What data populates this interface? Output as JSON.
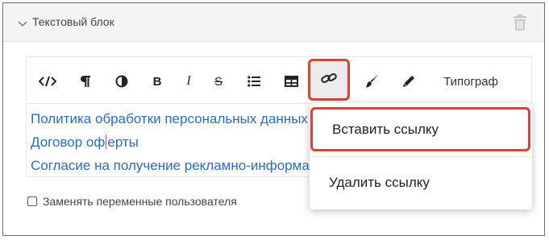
{
  "block": {
    "title": "Текстовый блок",
    "collapse_icon": "chevron-down-icon",
    "delete_icon": "trash-icon"
  },
  "toolbar": {
    "code_icon": "code-icon",
    "paragraph_icon": "pilcrow-icon",
    "contrast_icon": "contrast-icon",
    "bold_label": "B",
    "italic_label": "I",
    "strike_label": "S",
    "list_icon": "bulleted-list-icon",
    "table_icon": "table-icon",
    "link_icon": "link-icon",
    "brush_icon": "brush-icon",
    "pencil_icon": "pencil-icon",
    "typograph_label": "Типограф"
  },
  "content": {
    "lines": [
      "Политика обработки персональных данных",
      "Договор оферты",
      "Согласие на получение рекламно-информационных рассылок"
    ],
    "line2_before_cursor": "Договор оф",
    "line2_after_cursor": "ерты"
  },
  "options": {
    "replace_variables_label": "Заменять переменные пользователя",
    "replace_variables_checked": false
  },
  "link_menu": {
    "insert_label": "Вставить ссылку",
    "remove_label": "Удалить ссылку"
  },
  "colors": {
    "accent_highlight": "#d9413b",
    "link_text": "#2a6cc4"
  }
}
